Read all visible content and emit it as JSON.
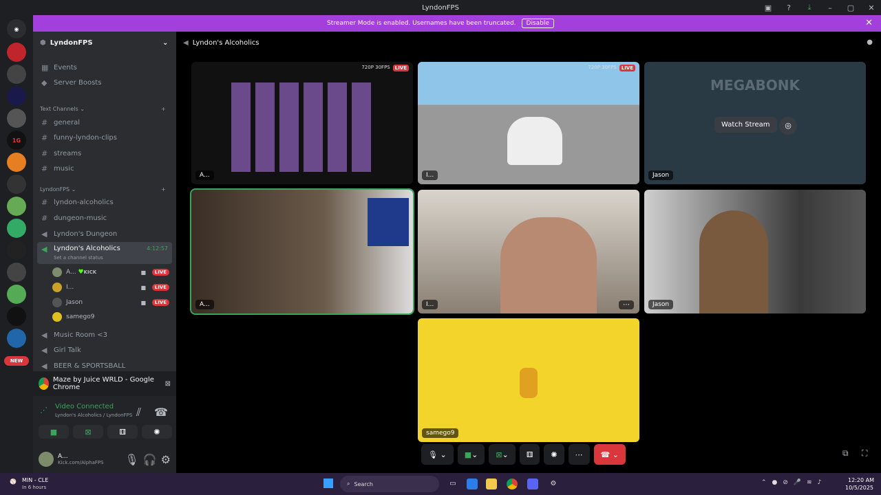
{
  "window": {
    "title": "LyndonFPS"
  },
  "banner": {
    "text": "Streamer Mode is enabled. Usernames have been truncated.",
    "button": "Disable"
  },
  "server": {
    "name": "LyndonFPS"
  },
  "sidebar": {
    "top_items": [
      {
        "label": "Events",
        "icon": "calendar-icon"
      },
      {
        "label": "Server Boosts",
        "icon": "boost-icon"
      }
    ],
    "text_category": "Text Channels",
    "text_channels": [
      "general",
      "funny-lyndon-clips",
      "streams",
      "music"
    ],
    "lyndon_category": "LyndonFPS",
    "lyndon_channels": [
      "lyndon-alcoholics",
      "dungeon-music"
    ],
    "voice_dungeon": "Lyndon's Dungeon",
    "active_voice": {
      "name": "Lyndon's Alcoholics",
      "timer": "4:12:57",
      "status": "Set a channel status"
    },
    "voice_users": [
      {
        "name": "A...",
        "extra": "KICK",
        "live": "LIVE",
        "color": "#7d8c6b"
      },
      {
        "name": "I...",
        "extra": "",
        "live": "LIVE",
        "color": "#c9a227"
      },
      {
        "name": "Jason",
        "extra": "",
        "live": "LIVE",
        "color": "#555555"
      },
      {
        "name": "samego9",
        "extra": "",
        "live": "",
        "color": "#e0c020"
      }
    ],
    "more_voice": [
      "Music Room <3",
      "Girl Talk",
      "BEER & SPORTSBALL"
    ]
  },
  "activity": {
    "text": "Maze by Juice WRLD - Google Chrome"
  },
  "voice_panel": {
    "status": "Video Connected",
    "sub": "Lyndon's Alcoholics / LyndonFPS"
  },
  "user": {
    "name": "A...",
    "status": "Kick.com/AlphaFPS"
  },
  "main": {
    "title": "Lyndon's Alcoholics",
    "tiles": [
      {
        "tag": "A...",
        "quality": "720P 30FPS",
        "live": "LIVE"
      },
      {
        "tag": "I...",
        "quality": "720P 30FPS",
        "live": "LIVE"
      },
      {
        "tag": "Jason",
        "game": "MEGABONK",
        "button": "Watch Stream"
      },
      {
        "tag": "A..."
      },
      {
        "tag": "I..."
      },
      {
        "tag": "Jason"
      },
      {
        "tag": "samego9"
      }
    ]
  },
  "taskbar": {
    "weather": "MIN - CLE",
    "weather_sub": "In 6 hours",
    "search": "Search",
    "time": "12:20 AM",
    "date": "10/5/2025"
  }
}
